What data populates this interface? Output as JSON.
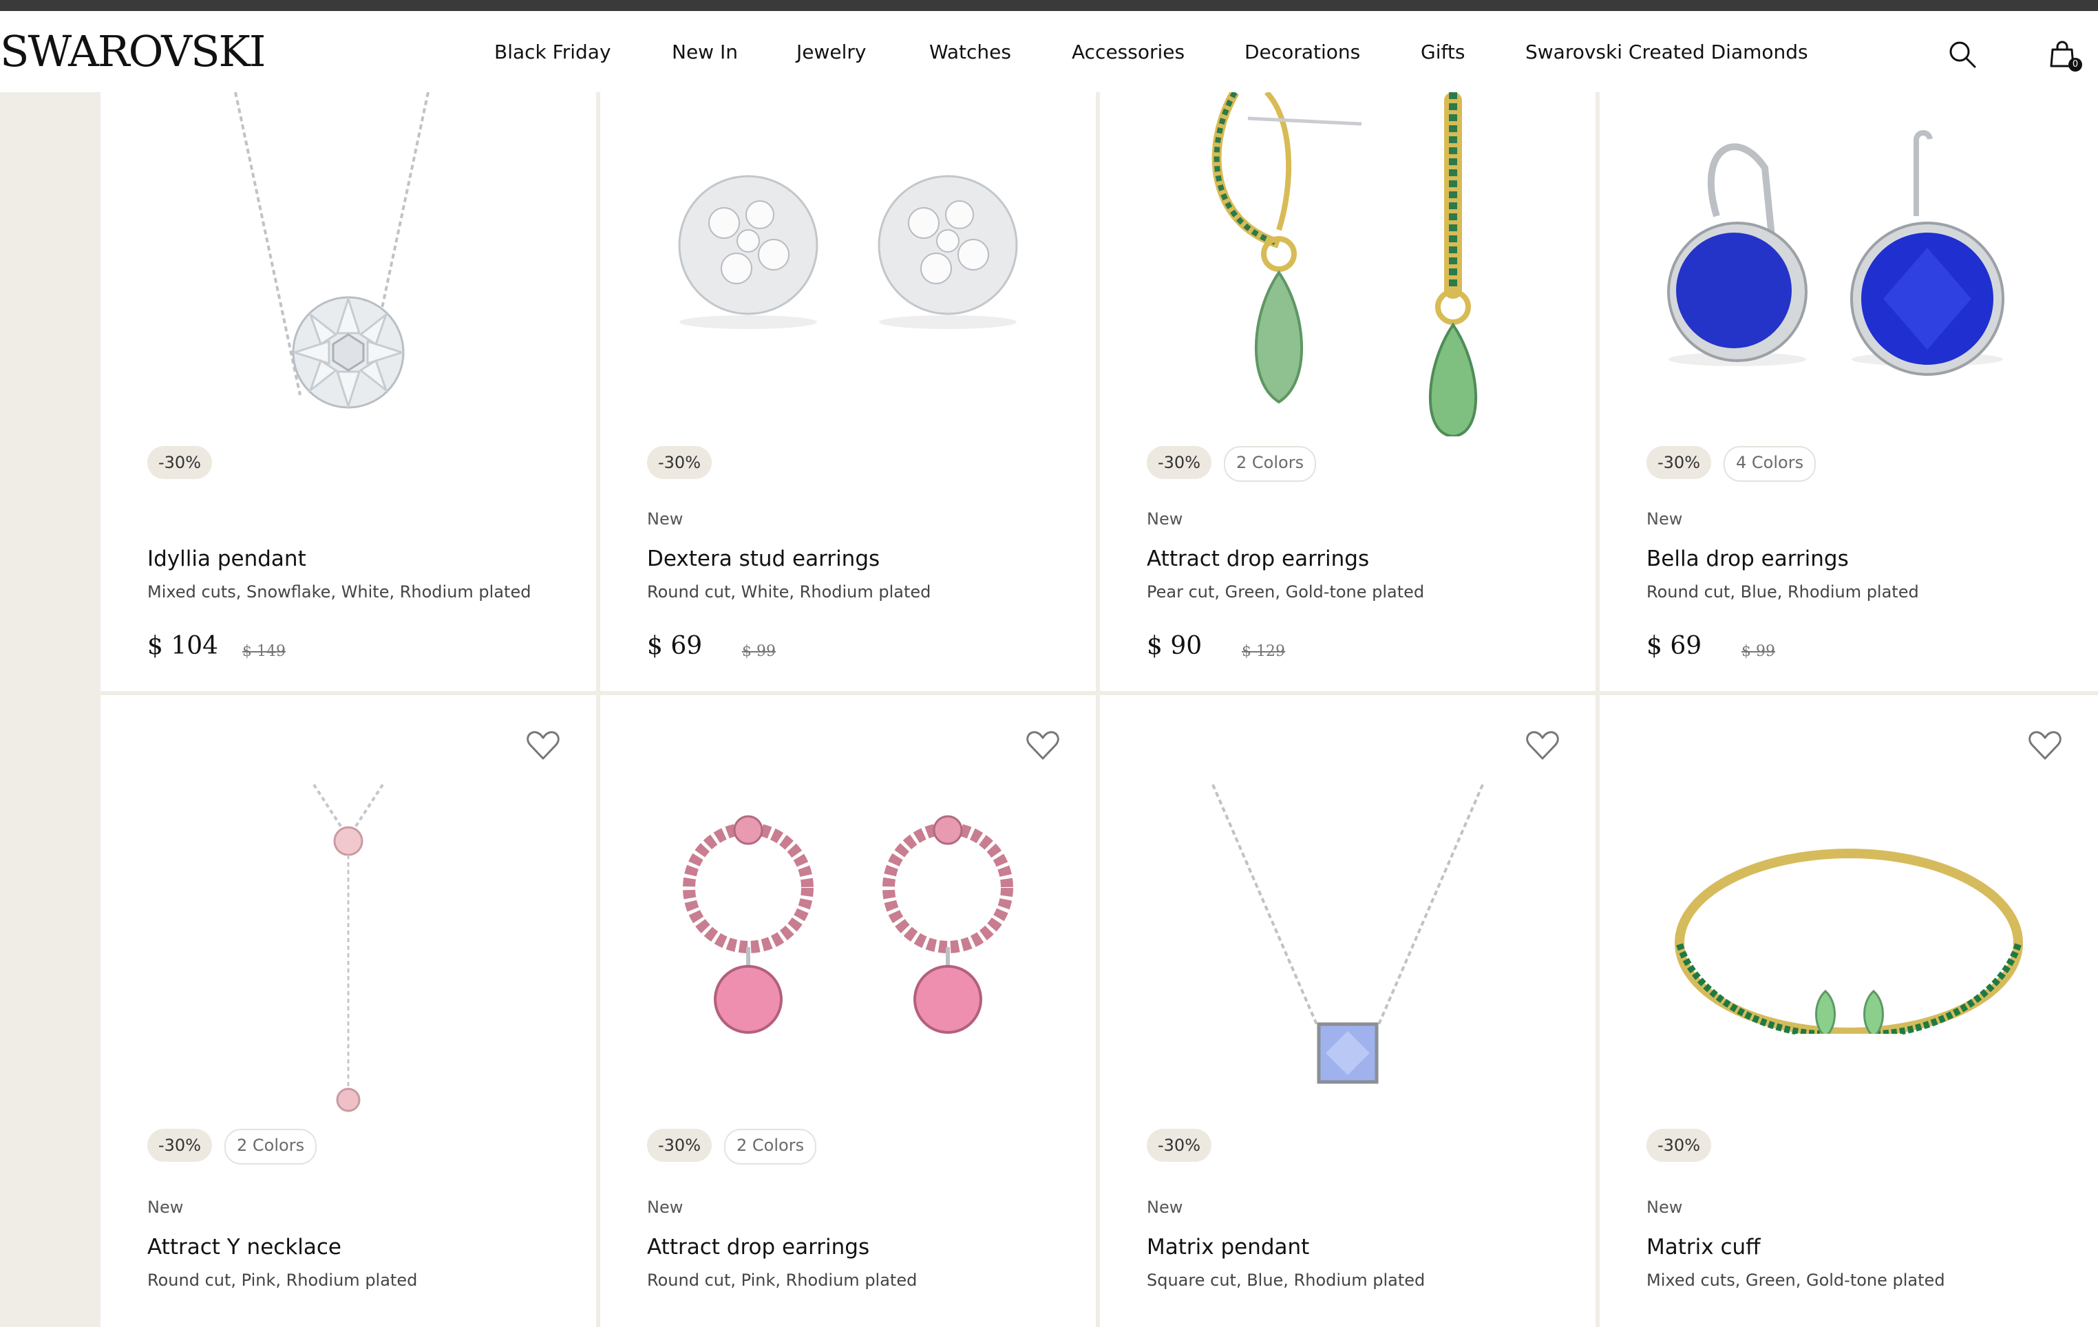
{
  "brand": {
    "logo_text": "SWAROVSKI"
  },
  "nav": {
    "items": [
      {
        "label": "Black Friday"
      },
      {
        "label": "New In"
      },
      {
        "label": "Jewelry"
      },
      {
        "label": "Watches"
      },
      {
        "label": "Accessories"
      },
      {
        "label": "Decorations"
      },
      {
        "label": "Gifts"
      },
      {
        "label": "Swarovski Created Diamonds"
      }
    ]
  },
  "header_icons": {
    "search": "search-icon",
    "cart": "shopping-bag-icon",
    "cart_count": "0"
  },
  "products": [
    {
      "badge": "-30%",
      "colors": "",
      "new_label": "",
      "name": "Idyllia pendant",
      "desc": "Mixed cuts, Snowflake, White, Rhodium plated",
      "price": "$ 104",
      "old_price": "$ 149",
      "image_icon": "pendant-necklace-clear-crystal"
    },
    {
      "badge": "-30%",
      "colors": "",
      "new_label": "New",
      "name": "Dextera stud earrings",
      "desc": "Round cut, White, Rhodium plated",
      "price": "$ 69",
      "old_price": "$ 99",
      "image_icon": "stud-earrings-clear-crystal"
    },
    {
      "badge": "-30%",
      "colors": "2 Colors",
      "new_label": "New",
      "name": "Attract drop earrings",
      "desc": "Pear cut, Green, Gold-tone plated",
      "price": "$ 90",
      "old_price": "$ 129",
      "image_icon": "drop-earrings-green-gold"
    },
    {
      "badge": "-30%",
      "colors": "4 Colors",
      "new_label": "New",
      "name": "Bella drop earrings",
      "desc": "Round cut, Blue, Rhodium plated",
      "price": "$ 69",
      "old_price": "$ 99",
      "image_icon": "drop-earrings-blue"
    },
    {
      "badge": "-30%",
      "colors": "2 Colors",
      "new_label": "New",
      "name": "Attract Y necklace",
      "desc": "Round cut, Pink, Rhodium plated",
      "image_icon": "y-necklace-pink"
    },
    {
      "badge": "-30%",
      "colors": "2 Colors",
      "new_label": "New",
      "name": "Attract drop earrings",
      "desc": "Round cut, Pink, Rhodium plated",
      "image_icon": "hoop-drop-earrings-pink"
    },
    {
      "badge": "-30%",
      "colors": "",
      "new_label": "New",
      "name": "Matrix pendant",
      "desc": "Square cut, Blue, Rhodium plated",
      "image_icon": "pendant-blue-square"
    },
    {
      "badge": "-30%",
      "colors": "",
      "new_label": "New",
      "name": "Matrix cuff",
      "desc": "Mixed cuts, Green, Gold-tone plated",
      "image_icon": "cuff-bracelet-green-gold"
    }
  ],
  "colors": {
    "accent_bg": "#f0ede6",
    "badge_bg": "#ede9e1",
    "header_bg": "#ffffff"
  }
}
